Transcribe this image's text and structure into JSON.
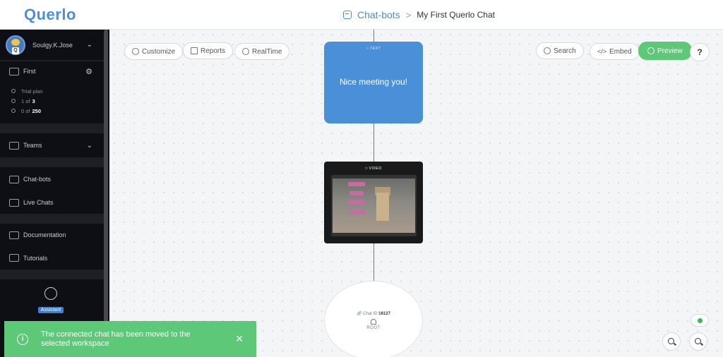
{
  "app": {
    "logo": "Querlo"
  },
  "breadcrumb": {
    "section": "Chat-bots",
    "separator": ">",
    "current": "My First Querlo Chat"
  },
  "sidebar": {
    "user": {
      "name": "Soulgy.K.Jose"
    },
    "workspace": {
      "name": "First"
    },
    "plan": {
      "label": "Trial plan",
      "seats_prefix": "1 of ",
      "seats_total": "3",
      "chats_prefix": "0 of ",
      "chats_total": "250"
    },
    "teams_label": "Teams",
    "nav": [
      {
        "label": "Chat-bots"
      },
      {
        "label": "Live Chats"
      },
      {
        "label": "Documentation"
      },
      {
        "label": "Tutorials"
      }
    ],
    "assistant_label": "Assistant"
  },
  "toolbar": {
    "customize": "Customize",
    "reports": "Reports",
    "realtime": "RealTime",
    "search": "Search",
    "embed": "Embed",
    "preview": "Preview",
    "help": "?"
  },
  "canvas": {
    "text_node": {
      "tag": "TEXT",
      "message": "Nice meeting you!"
    },
    "video_node": {
      "tag": "VIDEO"
    },
    "root_node": {
      "chat_id_label": "Chat ID:",
      "chat_id": "16127",
      "label": "ROOT"
    },
    "zoom_in": "+",
    "zoom_out": "−"
  },
  "toast": {
    "message": "The connected chat has been moved to the selected workspace",
    "close": "✕",
    "info": "i"
  },
  "colors": {
    "brand": "#4a90d9",
    "success": "#5cc878",
    "sidebar": "#0d0f14"
  }
}
